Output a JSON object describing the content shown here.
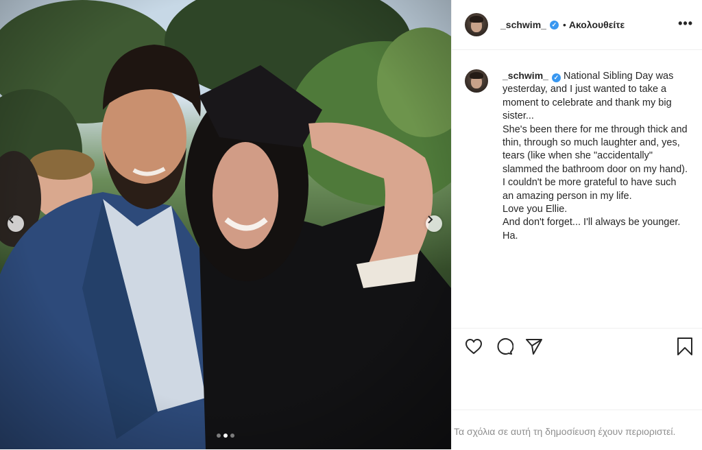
{
  "post": {
    "username": "_schwim_",
    "verified_glyph": "✓",
    "separator": "•",
    "follow_label": "Ακολουθείτε",
    "more_label": "•••",
    "caption": "National Sibling Day was yesterday, and I just wanted to take a moment to celebrate and thank my big sister...\nShe's been there for me through thick and thin, through so much laughter and, yes, tears (like when she \"accidentally\" slammed the bathroom door on my hand). I couldn't be more grateful to have such an amazing person in my life.\nLove you Ellie.\nAnd don't forget... I'll always be younger. Ha.",
    "comments_disabled_note": "Τα σχόλια σε αυτή τη δημοσίευση έχουν περιοριστεί."
  },
  "carousel": {
    "slide_count": 3,
    "active_slide": 2
  },
  "icons": {
    "like": "heart-icon",
    "comment": "comment-icon",
    "share": "paper-plane-icon",
    "save": "bookmark-icon",
    "prev": "chevron-left-icon",
    "next": "chevron-right-icon"
  },
  "colors": {
    "verified": "#3897f0",
    "text": "#262626",
    "muted": "#8e8e8e",
    "border": "#efefef"
  }
}
